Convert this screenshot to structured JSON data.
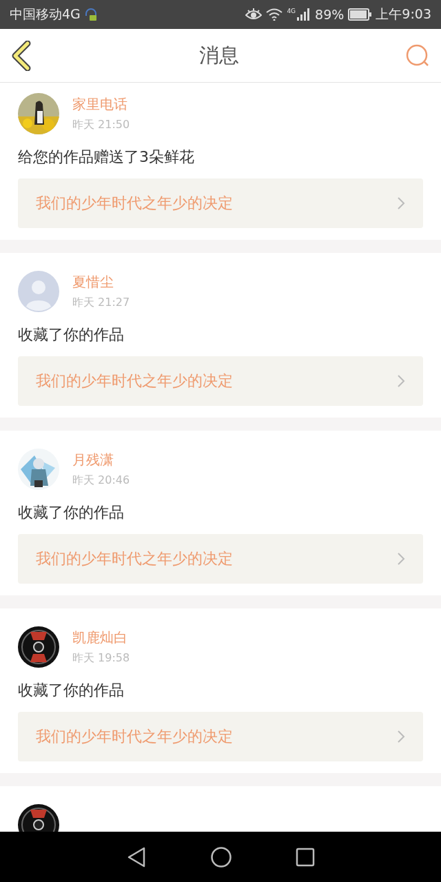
{
  "status_bar": {
    "carrier": "中国移动4G",
    "network": "4G",
    "battery": "89%",
    "time": "上午9:03"
  },
  "header": {
    "title": "消息"
  },
  "messages": [
    {
      "name": "家里电话",
      "time": "昨天 21:50",
      "action": "给您的作品赠送了3朵鲜花",
      "work": "我们的少年时代之年少的决定"
    },
    {
      "avatar": {
        "kind": "default"
      },
      "name": "夏惜尘",
      "time": "昨天 21:27",
      "action": "收藏了你的作品",
      "work": "我们的少年时代之年少的决定"
    },
    {
      "name": "月残潇",
      "time": "昨天 20:46",
      "action": "收藏了你的作品",
      "work": "我们的少年时代之年少的决定"
    },
    {
      "name": "凯鹿灿白",
      "time": "昨天 19:58",
      "action": "收藏了你的作品",
      "work": "我们的少年时代之年少的决定"
    }
  ]
}
